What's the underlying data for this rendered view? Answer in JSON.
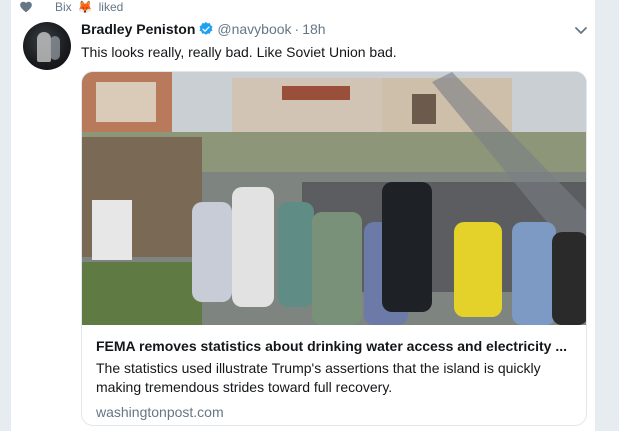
{
  "context": {
    "liked_by": "Bix",
    "action": "liked",
    "emoji": "🦊",
    "heart_icon": "heart-icon"
  },
  "tweet": {
    "author_name": "Bradley Peniston",
    "handle": "@navybook",
    "separator": "·",
    "time": "18h",
    "text": "This looks really, really bad. Like Soviet Union bad.",
    "verified_icon": "verified-badge-icon",
    "menu_icon": "chevron-down-icon"
  },
  "card": {
    "title": "FEMA removes statistics about drinking water access and electricity ...",
    "description": "The statistics used illustrate Trump's assertions that the island is quickly making tremendous strides toward full recovery.",
    "domain": "washingtonpost.com"
  },
  "colors": {
    "accent": "#1da1f2",
    "secondary_text": "#657786",
    "border": "#e1e8ed",
    "background": "#e6ecf0",
    "like": "#657786"
  }
}
